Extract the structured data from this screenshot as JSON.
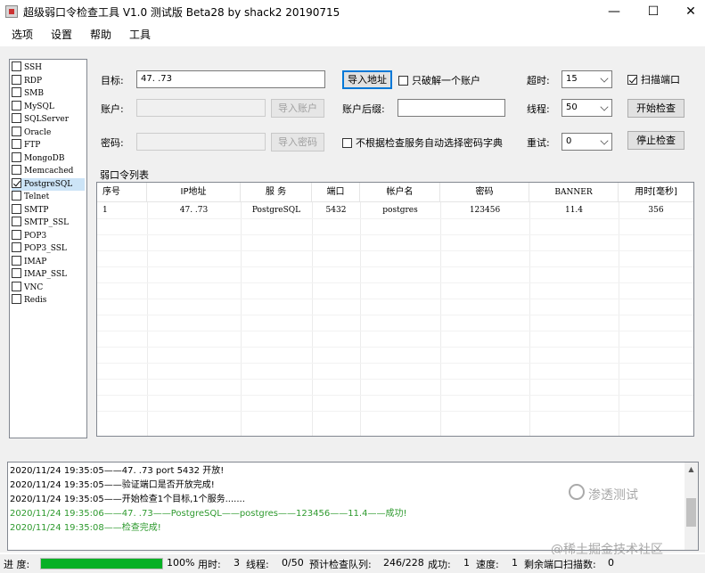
{
  "window": {
    "title": "超级弱口令检查工具 V1.0 测试版 Beta28 by shack2 20190715",
    "minimize": "—",
    "maximize": "☐",
    "close": "✕"
  },
  "menu": [
    "选项",
    "设置",
    "帮助",
    "工具"
  ],
  "services": [
    {
      "label": "SSH",
      "checked": false
    },
    {
      "label": "RDP",
      "checked": false
    },
    {
      "label": "SMB",
      "checked": false
    },
    {
      "label": "MySQL",
      "checked": false
    },
    {
      "label": "SQLServer",
      "checked": false
    },
    {
      "label": "Oracle",
      "checked": false
    },
    {
      "label": "FTP",
      "checked": false
    },
    {
      "label": "MongoDB",
      "checked": false
    },
    {
      "label": "Memcached",
      "checked": false
    },
    {
      "label": "PostgreSQL",
      "checked": true
    },
    {
      "label": "Telnet",
      "checked": false
    },
    {
      "label": "SMTP",
      "checked": false
    },
    {
      "label": "SMTP_SSL",
      "checked": false
    },
    {
      "label": "POP3",
      "checked": false
    },
    {
      "label": "POP3_SSL",
      "checked": false
    },
    {
      "label": "IMAP",
      "checked": false
    },
    {
      "label": "IMAP_SSL",
      "checked": false
    },
    {
      "label": "VNC",
      "checked": false
    },
    {
      "label": "Redis",
      "checked": false
    }
  ],
  "form": {
    "target_label": "目标:",
    "target_value": "47.        .73",
    "import_address": "导入地址",
    "only_one_account": "只破解一个账户",
    "timeout_label": "超时:",
    "timeout_value": "15",
    "scan_port": "扫描端口",
    "account_label": "账户:",
    "import_account": "导入账户",
    "account_suffix_label": "账户后缀:",
    "threads_label": "线程:",
    "threads_value": "50",
    "start_check": "开始检查",
    "password_label": "密码:",
    "import_password": "导入密码",
    "no_auto_dict": "不根据检查服务自动选择密码字典",
    "retry_label": "重试:",
    "retry_value": "0",
    "stop_check": "停止检查"
  },
  "grid": {
    "title": "弱口令列表",
    "columns": [
      "序号",
      "IP地址",
      "服 务",
      "端口",
      "帐户名",
      "密码",
      "BANNER",
      "用时[毫秒]"
    ],
    "rows": [
      [
        "1",
        "47.        .73",
        "PostgreSQL",
        "5432",
        "postgres",
        "123456",
        "11.4",
        "356"
      ]
    ]
  },
  "log": [
    {
      "text": "2020/11/24 19:35:05——47.        .73 port 5432 开放!",
      "color": "black"
    },
    {
      "text": "2020/11/24 19:35:05——验证端口是否开放完成!",
      "color": "black"
    },
    {
      "text": "2020/11/24 19:35:05——开始检查1个目标,1个服务.......",
      "color": "black"
    },
    {
      "text": "2020/11/24 19:35:06——47.        .73——PostgreSQL——postgres——123456——11.4——成功!",
      "color": "green"
    },
    {
      "text": "2020/11/24 19:35:08——检查完成!",
      "color": "green"
    }
  ],
  "watermark": {
    "line1": "渗透测试",
    "line2": "@稀土掘金技术社区"
  },
  "status": {
    "progress_label": "进 度:",
    "progress_fraction": 1.0,
    "progress_text": "100%",
    "elapsed_label": "用时:",
    "elapsed_value": "3",
    "threads_label": "线程:",
    "threads_value": "0/50",
    "queue_label": "预计检查队列:",
    "queue_value": "246/228",
    "success_label": "成功:",
    "success_value": "1",
    "speed_label": "速度:",
    "speed_value": "1",
    "remaining_label": "剩余端口扫描数:",
    "remaining_value": "0"
  },
  "colors": {
    "progress_green": "#06b025",
    "log_green": "#2e9a2e",
    "selection": "#cce4f7",
    "focus_border": "#0078d7"
  }
}
